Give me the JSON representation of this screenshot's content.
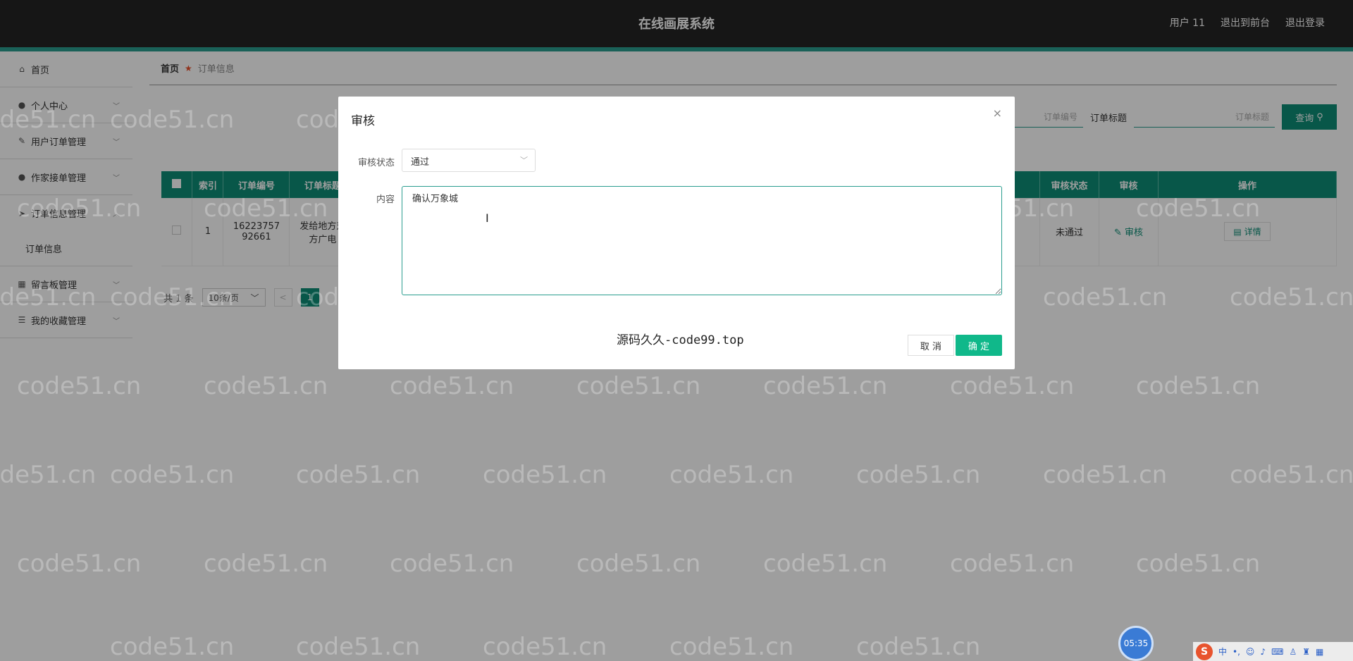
{
  "header": {
    "title": "在线画展系统",
    "user": "用户 11",
    "links": [
      "退出到前台",
      "退出登录"
    ]
  },
  "sidebar": {
    "items": [
      {
        "label": "首页",
        "icon": "home-icon"
      },
      {
        "label": "个人中心",
        "icon": "user-icon"
      },
      {
        "label": "用户订单管理",
        "icon": "edit-icon"
      },
      {
        "label": "作家接单管理",
        "icon": "user-icon"
      },
      {
        "label": "订单信息管理",
        "icon": "send-icon"
      },
      {
        "label": "订单信息",
        "icon": ""
      },
      {
        "label": "留言板管理",
        "icon": "grid-icon"
      },
      {
        "label": "我的收藏管理",
        "icon": "list-icon"
      }
    ]
  },
  "breadcrumb": {
    "home": "首页",
    "current": "订单信息"
  },
  "search": {
    "order_no_placeholder": "订单编号",
    "title_label": "订单标题",
    "title_placeholder": "订单标题",
    "button": "查询"
  },
  "table": {
    "headers": [
      "索引",
      "订单编号",
      "订单标题",
      "审核状态",
      "审核",
      "操作"
    ],
    "rows": [
      {
        "index": "1",
        "order_no": "1622375792661",
        "title": "发给地方对方广电",
        "status": "未通过",
        "review": "审核",
        "action": "详情"
      }
    ]
  },
  "pager": {
    "total": "共 1 条",
    "size": "10条/页",
    "prev": "<",
    "page": "1"
  },
  "dialog": {
    "title": "审核",
    "close": "×",
    "status_label": "审核状态",
    "status_value": "通过",
    "content_label": "内容",
    "content_value": "确认万象城",
    "source_tag": "源码久久-code99.top",
    "cancel": "取 消",
    "ok": "确 定"
  },
  "watermark": "code51.cn",
  "tray": {
    "clock": "05:35",
    "ime_logo": "S",
    "ime_mode": "中"
  }
}
